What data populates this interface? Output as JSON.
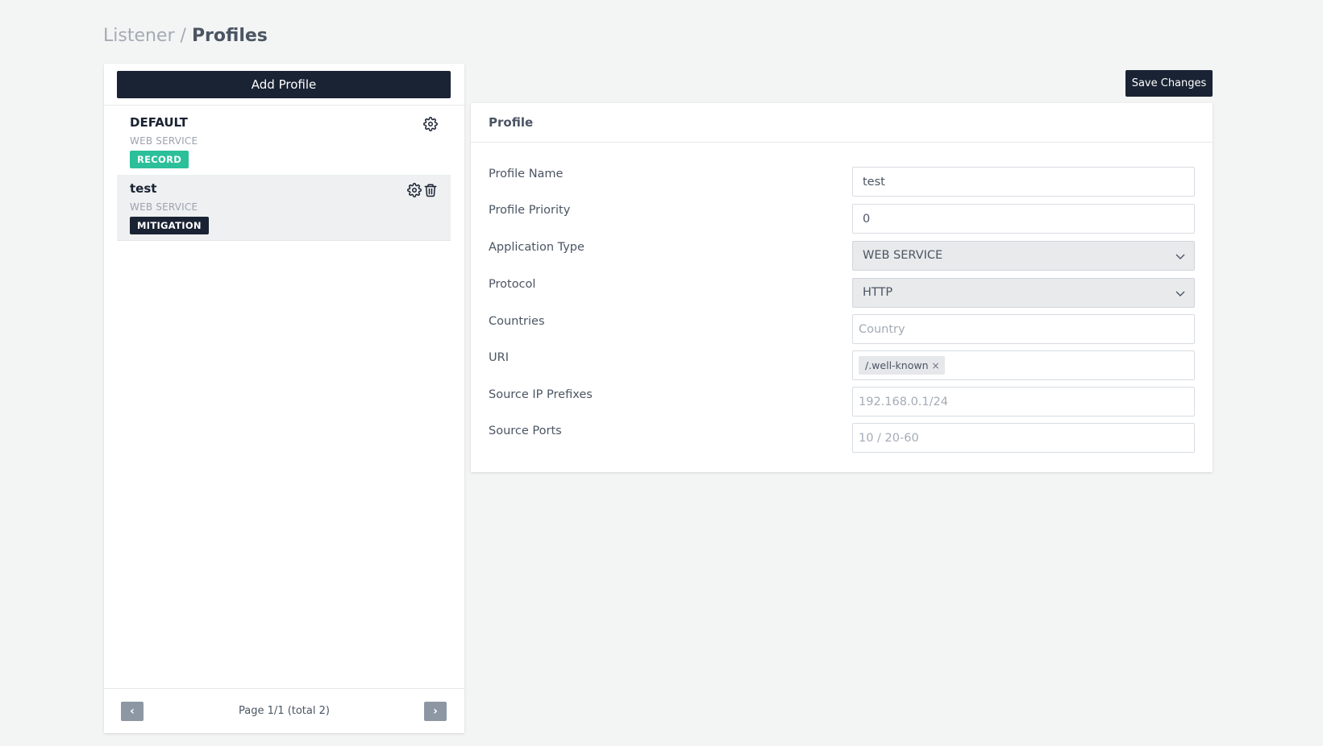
{
  "breadcrumb": {
    "parent": "Listener",
    "separator": "/",
    "current": "Profiles"
  },
  "left_panel": {
    "add_profile_label": "Add Profile",
    "profiles": [
      {
        "name": "DEFAULT",
        "type": "WEB SERVICE",
        "badge": "RECORD",
        "icons": [
          "gear-icon"
        ]
      },
      {
        "name": "test",
        "type": "WEB SERVICE",
        "badge": "MITIGATION",
        "icons": [
          "gear-icon",
          "trash-icon"
        ],
        "selected": true
      }
    ],
    "pagination": {
      "text": "Page 1/1 (total 2)",
      "prev_icon": "chevron-left-icon",
      "next_icon": "chevron-right-icon"
    }
  },
  "toolbar": {
    "save_label": "Save Changes"
  },
  "form": {
    "title": "Profile",
    "fields": {
      "profile_name": {
        "label": "Profile Name",
        "value": "test"
      },
      "profile_priority": {
        "label": "Profile Priority",
        "value": "0"
      },
      "application_type": {
        "label": "Application Type",
        "value": "WEB SERVICE"
      },
      "protocol": {
        "label": "Protocol",
        "value": "HTTP"
      },
      "countries": {
        "label": "Countries",
        "placeholder": "Country"
      },
      "uri": {
        "label": "URI",
        "tags": [
          "/.well-known"
        ],
        "remove_glyph": "×"
      },
      "source_ip_prefixes": {
        "label": "Source IP Prefixes",
        "placeholder": "192.168.0.1/24"
      },
      "source_ports": {
        "label": "Source Ports",
        "placeholder": "10 / 20-60"
      }
    }
  },
  "colors": {
    "background": "#f3f4f4",
    "primary_dark": "#1a2333",
    "record_badge": "#2bbf9a",
    "pager_button": "#8c97a3"
  }
}
